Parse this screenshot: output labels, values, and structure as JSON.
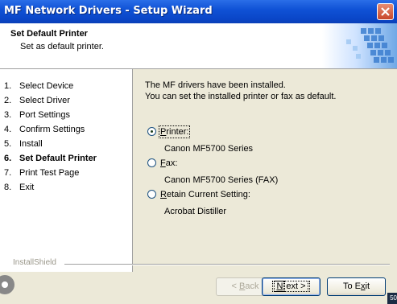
{
  "window": {
    "title": "MF Network Drivers - Setup Wizard"
  },
  "header": {
    "title": "Set Default Printer",
    "subtitle": "Set as default printer."
  },
  "steps": [
    {
      "num": "1.",
      "label": "Select Device"
    },
    {
      "num": "2.",
      "label": "Select Driver"
    },
    {
      "num": "3.",
      "label": "Port Settings"
    },
    {
      "num": "4.",
      "label": "Confirm Settings"
    },
    {
      "num": "5.",
      "label": "Install"
    },
    {
      "num": "6.",
      "label": "Set Default Printer",
      "active": true
    },
    {
      "num": "7.",
      "label": "Print Test Page"
    },
    {
      "num": "8.",
      "label": "Exit"
    }
  ],
  "main": {
    "line1": "The MF drivers have been installed.",
    "line2": "You can set the installed printer or fax as default.",
    "options": [
      {
        "label_accel": "P",
        "label_rest": "rinter:",
        "value": "Canon MF5700 Series",
        "selected": true
      },
      {
        "label_accel": "F",
        "label_rest": "ax:",
        "value": "Canon MF5700 Series (FAX)",
        "selected": false
      },
      {
        "label_accel": "R",
        "label_rest": "etain Current Setting:",
        "value": "Acrobat Distiller",
        "selected": false
      }
    ]
  },
  "footer": {
    "brand": "InstallShield"
  },
  "buttons": {
    "back": {
      "pre": "< ",
      "accel": "B",
      "rest": "ack"
    },
    "next": {
      "accel": "N",
      "rest": "ext >"
    },
    "exit": {
      "pre": "To E",
      "accel": "x",
      "rest": "it"
    }
  },
  "corner_badge": "50",
  "colors": {
    "titlebar": "#0a46c8",
    "dialog_bg": "#ece9d8"
  }
}
